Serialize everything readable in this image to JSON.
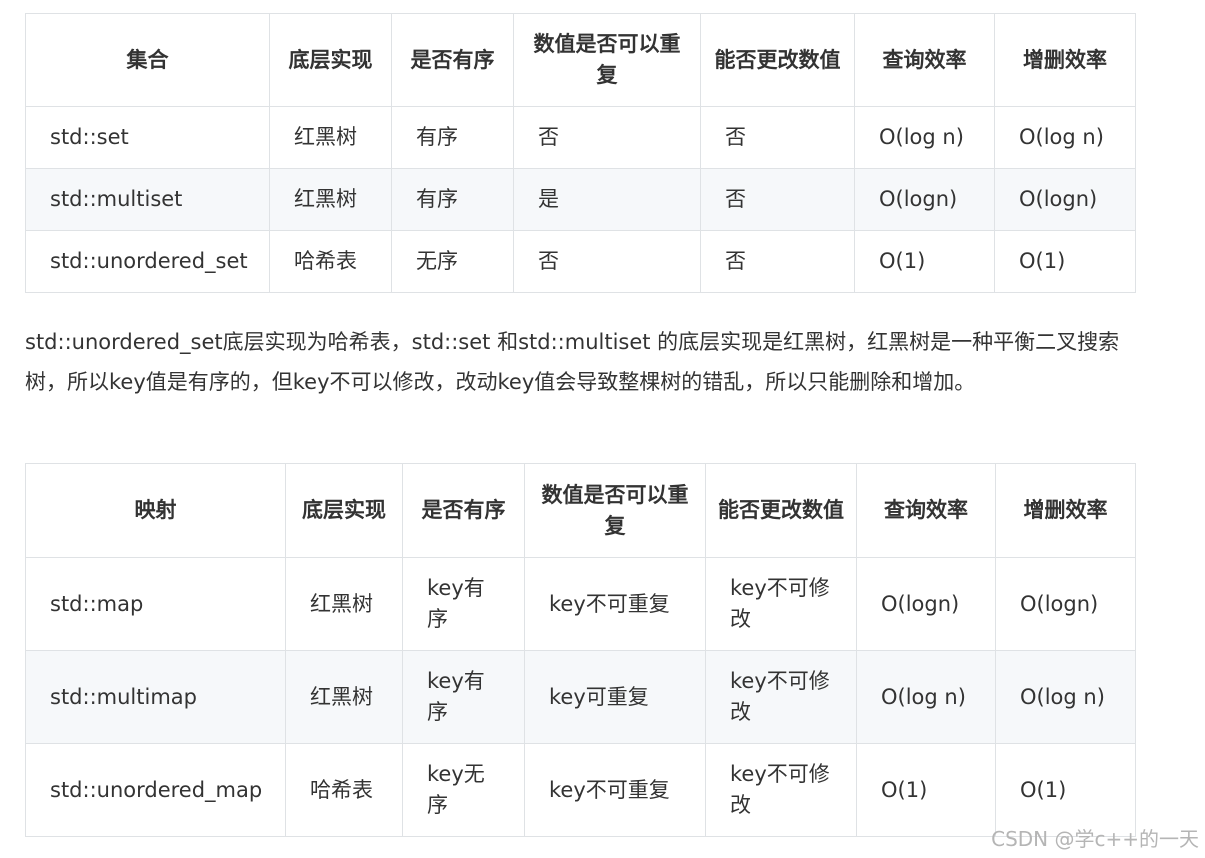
{
  "set_table": {
    "headers": [
      "集合",
      "底层实现",
      "是否有序",
      "数值是否可以重复",
      "能否更改数值",
      "查询效率",
      "增删效率"
    ],
    "rows": [
      [
        "std::set",
        "红黑树",
        "有序",
        "否",
        "否",
        "O(log n)",
        "O(log n)"
      ],
      [
        "std::multiset",
        "红黑树",
        "有序",
        "是",
        "否",
        "O(logn)",
        "O(logn)"
      ],
      [
        "std::unordered_set",
        "哈希表",
        "无序",
        "否",
        "否",
        "O(1)",
        "O(1)"
      ]
    ]
  },
  "paragraph": "std::unordered_set底层实现为哈希表，std::set 和std::multiset 的底层实现是红黑树，红黑树是一种平衡二叉搜索树，所以key值是有序的，但key不可以修改，改动key值会导致整棵树的错乱，所以只能删除和增加。",
  "map_table": {
    "headers": [
      "映射",
      "底层实现",
      "是否有序",
      "数值是否可以重复",
      "能否更改数值",
      "查询效率",
      "增删效率"
    ],
    "rows": [
      [
        "std::map",
        "红黑树",
        "key有序",
        "key不可重复",
        "key不可修改",
        "O(logn)",
        "O(logn)"
      ],
      [
        "std::multimap",
        "红黑树",
        "key有序",
        "key可重复",
        "key不可修改",
        "O(log n)",
        "O(log n)"
      ],
      [
        "std::unordered_map",
        "哈希表",
        "key无序",
        "key不可重复",
        "key不可修改",
        "O(1)",
        "O(1)"
      ]
    ]
  },
  "watermark": "CSDN @学c++的一天"
}
